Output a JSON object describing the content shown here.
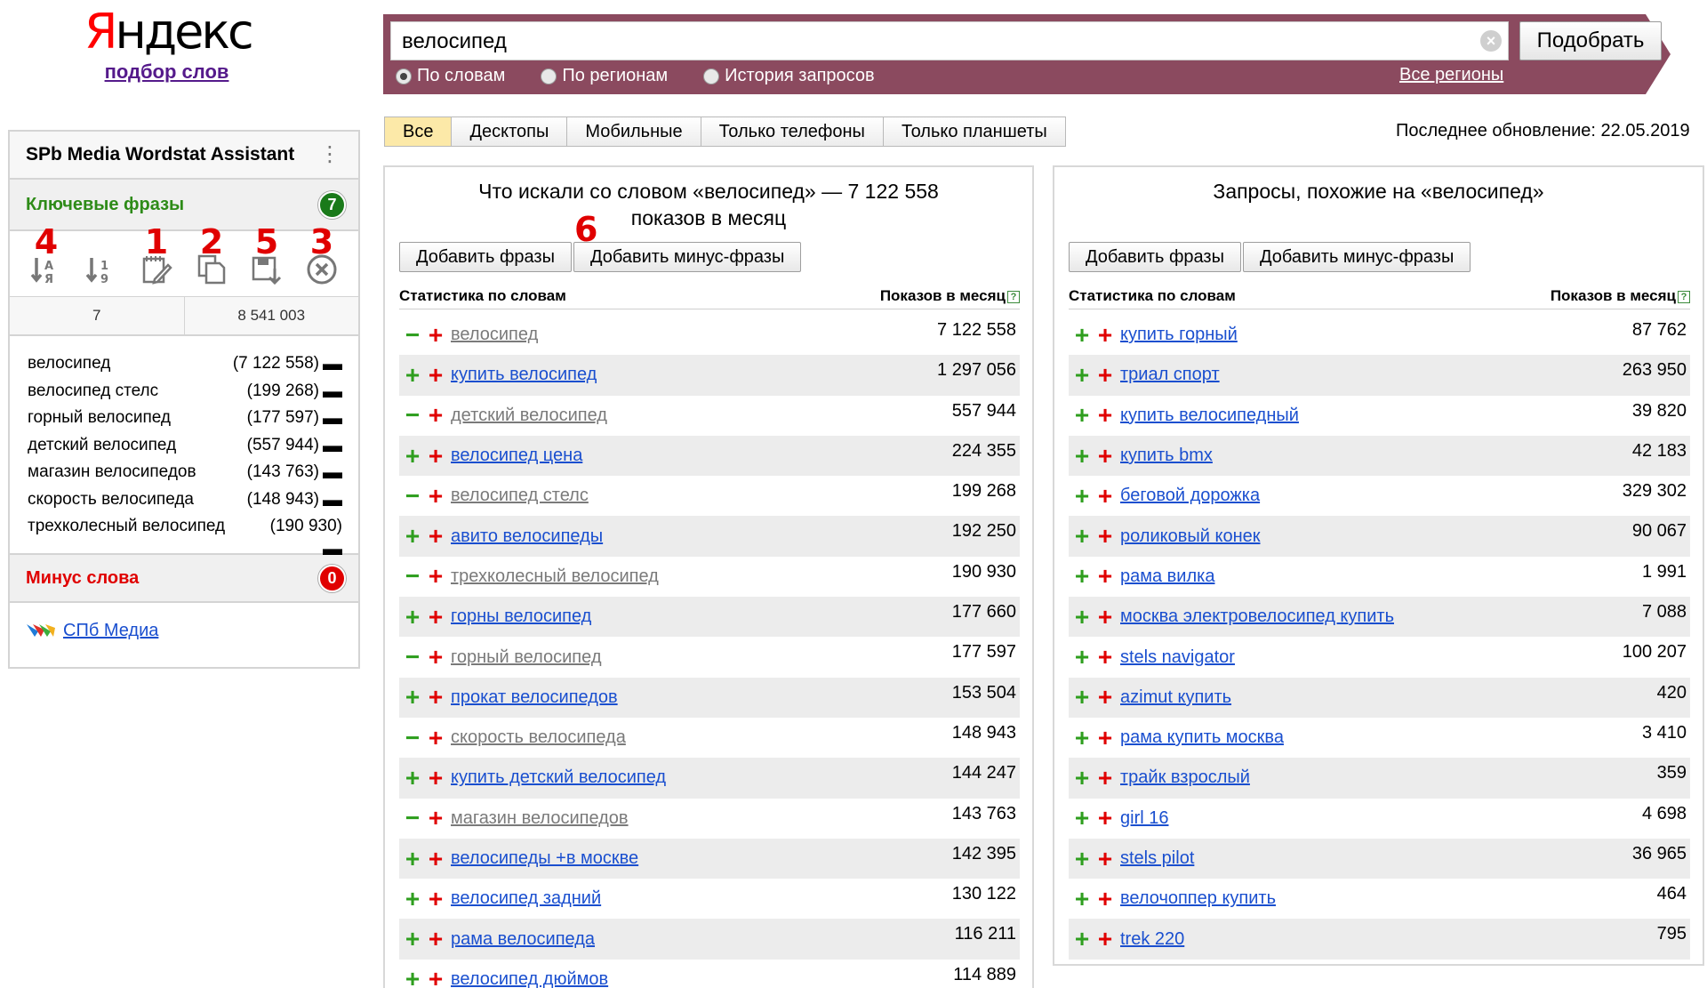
{
  "logo": {
    "brand": "Яндекс",
    "subtitle": "подбор слов"
  },
  "panel": {
    "title": "SPb Media Wordstat Assistant",
    "keywords_title": "Ключевые фразы",
    "keywords_count": "7",
    "tool_numbers": [
      "4",
      "1",
      "2",
      "5",
      "3"
    ],
    "stats": {
      "phrases": "7",
      "total": "8 541 003"
    },
    "phrases": [
      {
        "text": "велосипед",
        "count": "(7 122 558)"
      },
      {
        "text": "велосипед стелс",
        "count": "(199 268)"
      },
      {
        "text": "горный велосипед",
        "count": "(177 597)"
      },
      {
        "text": "детский велосипед",
        "count": "(557 944)"
      },
      {
        "text": "магазин велосипедов",
        "count": "(143 763)"
      },
      {
        "text": "скорость велосипеда",
        "count": "(148 943)"
      },
      {
        "text": "трехколесный велосипед",
        "count": "(190 930)"
      }
    ],
    "minus_title": "Минус слова",
    "minus_count": "0",
    "spb_link": "СПб Медиа"
  },
  "search": {
    "query": "велосипед",
    "button": "Подобрать",
    "radios": [
      {
        "label": "По словам",
        "checked": true
      },
      {
        "label": "По регионам",
        "checked": false
      },
      {
        "label": "История запросов",
        "checked": false
      }
    ],
    "all_regions": "Все регионы"
  },
  "tabs": [
    "Все",
    "Десктопы",
    "Мобильные",
    "Только телефоны",
    "Только планшеты"
  ],
  "last_update": "Последнее обновление: 22.05.2019",
  "left_column": {
    "title_line1": "Что искали со словом «велосипед» — 7 122 558",
    "title_line2": "показов в месяц",
    "marker": "6",
    "add_phrases": "Добавить фразы",
    "add_minus": "Добавить минус-фразы",
    "stat_label": "Статистика по словам",
    "shows_label": "Показов в месяц",
    "rows": [
      {
        "sign": "−",
        "added": true,
        "phrase": "велосипед",
        "count": "7 122 558"
      },
      {
        "sign": "+",
        "added": false,
        "phrase": "купить велосипед",
        "count": "1 297 056"
      },
      {
        "sign": "−",
        "added": true,
        "phrase": "детский велосипед",
        "count": "557 944"
      },
      {
        "sign": "+",
        "added": false,
        "phrase": "велосипед цена",
        "count": "224 355"
      },
      {
        "sign": "−",
        "added": true,
        "phrase": "велосипед стелс",
        "count": "199 268"
      },
      {
        "sign": "+",
        "added": false,
        "phrase": "авито велосипеды",
        "count": "192 250"
      },
      {
        "sign": "−",
        "added": true,
        "phrase": "трехколесный велосипед",
        "count": "190 930"
      },
      {
        "sign": "+",
        "added": false,
        "phrase": "горны велосипед",
        "count": "177 660"
      },
      {
        "sign": "−",
        "added": true,
        "phrase": "горный велосипед",
        "count": "177 597"
      },
      {
        "sign": "+",
        "added": false,
        "phrase": "прокат велосипедов",
        "count": "153 504"
      },
      {
        "sign": "−",
        "added": true,
        "phrase": "скорость велосипеда",
        "count": "148 943"
      },
      {
        "sign": "+",
        "added": false,
        "phrase": "купить детский велосипед",
        "count": "144 247"
      },
      {
        "sign": "−",
        "added": true,
        "phrase": "магазин велосипедов",
        "count": "143 763"
      },
      {
        "sign": "+",
        "added": false,
        "phrase": "велосипеды +в москве",
        "count": "142 395"
      },
      {
        "sign": "+",
        "added": false,
        "phrase": "велосипед задний",
        "count": "130 122"
      },
      {
        "sign": "+",
        "added": false,
        "phrase": "рама велосипеда",
        "count": "116 211"
      },
      {
        "sign": "+",
        "added": false,
        "phrase": "велосипед дюймов",
        "count": "114 889"
      }
    ]
  },
  "right_column": {
    "title": "Запросы, похожие на «велосипед»",
    "add_phrases": "Добавить фразы",
    "add_minus": "Добавить минус-фразы",
    "stat_label": "Статистика по словам",
    "shows_label": "Показов в месяц",
    "rows": [
      {
        "sign": "+",
        "phrase": "купить горный",
        "count": "87 762"
      },
      {
        "sign": "+",
        "phrase": "триал спорт",
        "count": "263 950"
      },
      {
        "sign": "+",
        "phrase": "купить велосипедный",
        "count": "39 820"
      },
      {
        "sign": "+",
        "phrase": "купить bmx",
        "count": "42 183"
      },
      {
        "sign": "+",
        "phrase": "беговой дорожка",
        "count": "329 302"
      },
      {
        "sign": "+",
        "phrase": "роликовый конек",
        "count": "90 067"
      },
      {
        "sign": "+",
        "phrase": "рама вилка",
        "count": "1 991"
      },
      {
        "sign": "+",
        "phrase": "москва электровелосипед купить",
        "count": "7 088"
      },
      {
        "sign": "+",
        "phrase": "stels navigator",
        "count": "100 207"
      },
      {
        "sign": "+",
        "phrase": "azimut купить",
        "count": "420"
      },
      {
        "sign": "+",
        "phrase": "рама купить москва",
        "count": "3 410"
      },
      {
        "sign": "+",
        "phrase": "трайк взрослый",
        "count": "359"
      },
      {
        "sign": "+",
        "phrase": "girl 16",
        "count": "4 698"
      },
      {
        "sign": "+",
        "phrase": "stels pilot",
        "count": "36 965"
      },
      {
        "sign": "+",
        "phrase": "велочоппер купить",
        "count": "464"
      },
      {
        "sign": "+",
        "phrase": "trek 220",
        "count": "795"
      }
    ]
  }
}
